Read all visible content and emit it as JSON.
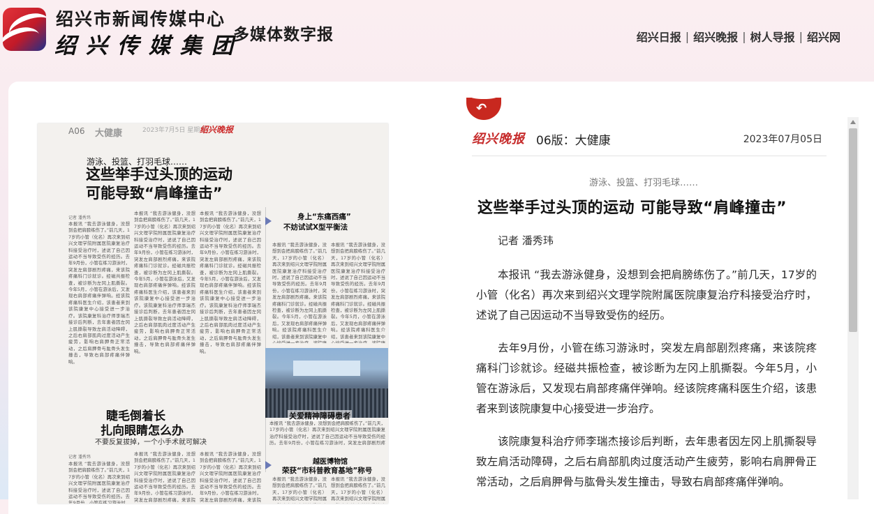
{
  "header": {
    "org_name": "绍兴市新闻传媒中心",
    "org_brand": "绍兴传媒集团",
    "site_title": "多媒体数字报",
    "nav": [
      {
        "label": "绍兴日报"
      },
      {
        "label": "绍兴晚报"
      },
      {
        "label": "树人导报"
      },
      {
        "label": "绍兴网"
      }
    ],
    "nav_separator": "|"
  },
  "page_image": {
    "page_no": "A06",
    "section": "大健康",
    "date_strip": "2023年7月5日 星期三",
    "mini_logo": "绍兴晚报",
    "kicker": "游泳、投篮、打羽毛球……",
    "headline_line1": "这些举手过头顶的运动",
    "headline_line2": "可能导致“肩峰撞击”",
    "story2_headline_line1": "睫毛倒着长",
    "story2_headline_line2": "扎向眼睛怎么办",
    "story2_sub": "不要反复拔掉，一个小手术就可解决",
    "side1_headline_line1": "身上“东痛西痛”",
    "side1_headline_line2": "不妨试试X型平衡法",
    "photo_caption": "关爱精神障碍患者",
    "side2_headline_line1": "越医博物馆",
    "side2_headline_line2": "荣获“市科普教育基地”称号",
    "byline1": "记者 潘秀玮",
    "byline2": "记者 潘秀玮",
    "col_text": "本报讯 “我去游泳健身，没想到会把肩膀练伤了。”前几天，17岁的小管（化名）再次来到绍兴文理学院附属医院康复治疗科接受治疗时，述说了自己因运动不当导致受伤的经历。去年9月份，小管在练习游泳时，突发左肩部剧烈疼痛，来该院疼痛科门诊就诊。经磁共振检查，被诊断为左冈上肌撕裂。今年5月，小管在游泳后，又发现右肩部疼痛伴弹响。经该院疼痛科医生介绍，该患者来到该院康复中心接受进一步治疗。该院康复科治疗师李瑞杰接诊后判断，去年患者因左冈上肌撕裂导致左肩活动障碍，之后右肩部肌肉过度活动产生疲劳，影响右肩胛骨正常活动，之后肩胛骨与肱骨头发生撞击，导致右肩部疼痛伴弹响。"
  },
  "reader": {
    "back_glyph": "↶",
    "paper_logo": "绍兴晚报",
    "section": "06版：大健康",
    "date": "2023年07月05日",
    "kicker": "游泳、投篮、打羽毛球……",
    "title": "这些举手过头顶的运动 可能导致“肩峰撞击”",
    "byline": "记者 潘秀玮",
    "paragraphs": [
      "本报讯 “我去游泳健身，没想到会把肩膀练伤了。”前几天，17岁的小管（化名）再次来到绍兴文理学院附属医院康复治疗科接受治疗时，述说了自己因运动不当导致受伤的经历。",
      "去年9月份，小管在练习游泳时，突发左肩部剧烈疼痛，来该院疼痛科门诊就诊。经磁共振检查，被诊断为左冈上肌撕裂。今年5月，小管在游泳后，又发现右肩部疼痛伴弹响。经该院疼痛科医生介绍，该患者来到该院康复中心接受进一步治疗。",
      "该院康复科治疗师李瑞杰接诊后判断，去年患者因左冈上肌撕裂导致左肩活动障碍，之后右肩部肌肉过度活动产生疲劳，影响右肩胛骨正常活动，之后肩胛骨与肱骨头发生撞击，导致右肩部疼痛伴弹响。"
    ]
  }
}
